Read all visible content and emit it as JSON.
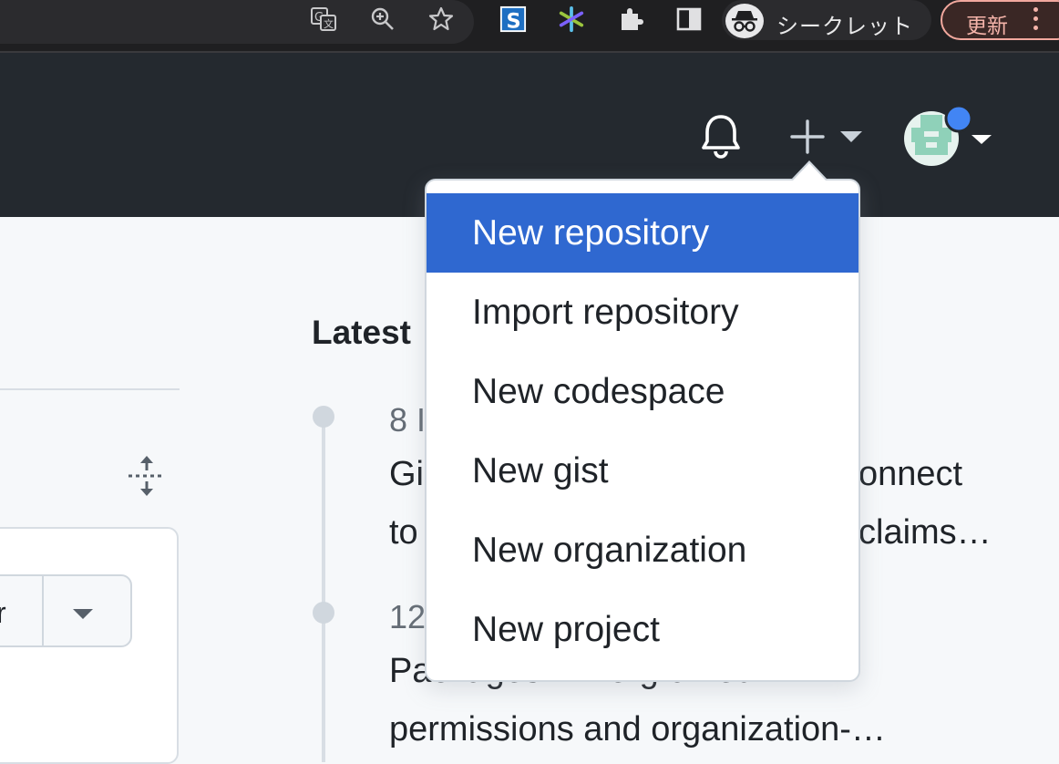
{
  "browser": {
    "incognito_label": "シークレット",
    "update_label": "更新",
    "toolbar_icons": [
      "translate-icon",
      "zoom-icon",
      "bookmark-star-icon",
      "extension-s-icon",
      "extension-sparkle-icon",
      "puzzle-icon",
      "side-panel-icon",
      "incognito-icon",
      "kebab-menu-icon"
    ]
  },
  "header": {
    "icons": [
      "bell-icon",
      "plus-icon",
      "caret-down-icon",
      "avatar"
    ]
  },
  "sidebar": {
    "split_button_text": "r"
  },
  "main": {
    "latest_title": "Latest",
    "feed": [
      {
        "date": "8 I",
        "line1": "Gi",
        "line1_right": "onnect",
        "line2": "to",
        "line2_right": "claims…"
      },
      {
        "date": "12",
        "line1": "Packages: Fine-grained",
        "line2": "permissions and organization-…"
      }
    ]
  },
  "dropdown": {
    "items": [
      {
        "label": "New repository",
        "active": true
      },
      {
        "label": "Import repository",
        "active": false
      },
      {
        "label": "New codespace",
        "active": false
      },
      {
        "label": "New gist",
        "active": false
      },
      {
        "label": "New organization",
        "active": false
      },
      {
        "label": "New project",
        "active": false
      }
    ]
  },
  "colors": {
    "accent": "#2f68d0",
    "header_bg": "#24292f",
    "notification_dot": "#4285f4"
  }
}
